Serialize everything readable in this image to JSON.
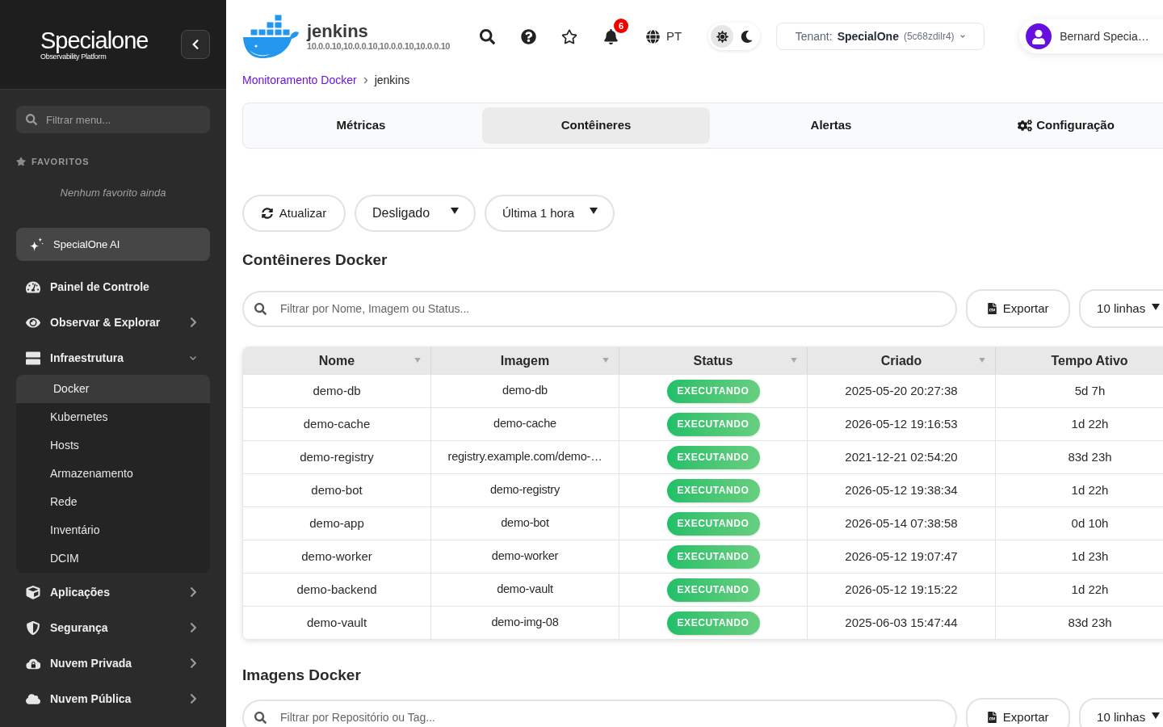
{
  "sidebar": {
    "brand": {
      "name": "Specialone",
      "tagline": "Observability Platform"
    },
    "search": {
      "placeholder": "Filtrar menu..."
    },
    "favorites": {
      "title": "FAVORITOS",
      "empty_text": "Nenhum favorito ainda"
    },
    "ai_button": "SpecialOne AI",
    "nav": [
      {
        "label": "Painel de Controle"
      },
      {
        "label": "Observar & Explorar",
        "expanded": false
      },
      {
        "label": "Infraestrutura",
        "expanded": true,
        "children": [
          {
            "label": "Docker",
            "selected": true
          },
          {
            "label": "Kubernetes",
            "selected": false
          },
          {
            "label": "Hosts",
            "selected": false
          },
          {
            "label": "Armazenamento",
            "selected": false
          },
          {
            "label": "Rede",
            "selected": false
          },
          {
            "label": "Inventário",
            "selected": false
          },
          {
            "label": "DCIM",
            "selected": false
          }
        ]
      },
      {
        "label": "Aplicações",
        "expanded": false
      },
      {
        "label": "Segurança",
        "expanded": false
      },
      {
        "label": "Nuvem Privada",
        "expanded": false
      },
      {
        "label": "Nuvem Pública",
        "expanded": false
      }
    ]
  },
  "header": {
    "title": "jenkins",
    "subtitle": "10.0.0.10,10.0.0.10,10.0.0.10,10.0.0.10",
    "notifications": "6",
    "language": "PT",
    "theme": [
      {
        "kind": "light",
        "selected": true
      },
      {
        "kind": "dark",
        "selected": false
      }
    ],
    "tenant": {
      "label": "Tenant:",
      "name": "SpecialOne",
      "id": "(5c68zdilr4)"
    },
    "user": "Bernard Specia…"
  },
  "breadcrumb": [
    "Monitoramento Docker",
    "jenkins"
  ],
  "tabs": [
    {
      "label": "Métricas",
      "selected": false,
      "kind": "plain"
    },
    {
      "label": "Contêineres",
      "selected": true,
      "kind": "plain"
    },
    {
      "label": "Alertas",
      "selected": false,
      "kind": "plain"
    },
    {
      "label": "Configuração",
      "selected": false,
      "kind": "settings"
    }
  ],
  "controls": {
    "refresh": "Atualizar",
    "auto_refresh": "Desligado",
    "time_range": "Última 1 hora"
  },
  "containers": {
    "title": "Contêineres Docker",
    "search": {
      "placeholder": "Filtrar por Nome, Imagem ou Status..."
    },
    "export": "Exportar",
    "page_size": "10 linhas",
    "table": {
      "columns": [
        {
          "label": "Nome",
          "sortable": true
        },
        {
          "label": "Imagem",
          "sortable": true
        },
        {
          "label": "Status",
          "sortable": true
        },
        {
          "label": "Criado",
          "sortable": true
        },
        {
          "label": "Tempo Ativo"
        }
      ],
      "rows": [
        {
          "name": "demo-db",
          "image": "demo-db",
          "status": {
            "label": "EXECUTANDO",
            "kind": "running"
          },
          "created": "2025-05-20 20:27:38",
          "uptime": "5d 7h"
        },
        {
          "name": "demo-cache",
          "image": "demo-cache",
          "status": {
            "label": "EXECUTANDO",
            "kind": "running"
          },
          "created": "2026-05-12 19:16:53",
          "uptime": "1d 22h"
        },
        {
          "name": "demo-registry",
          "image": "registry.example.com/demo-…",
          "status": {
            "label": "EXECUTANDO",
            "kind": "running"
          },
          "created": "2021-12-21 02:54:20",
          "uptime": "83d 23h"
        },
        {
          "name": "demo-bot",
          "image": "demo-registry",
          "status": {
            "label": "EXECUTANDO",
            "kind": "running"
          },
          "created": "2026-05-12 19:38:34",
          "uptime": "1d 22h"
        },
        {
          "name": "demo-app",
          "image": "demo-bot",
          "status": {
            "label": "EXECUTANDO",
            "kind": "running"
          },
          "created": "2026-05-14 07:38:58",
          "uptime": "0d 10h"
        },
        {
          "name": "demo-worker",
          "image": "demo-worker",
          "status": {
            "label": "EXECUTANDO",
            "kind": "running"
          },
          "created": "2026-05-12 19:07:47",
          "uptime": "1d 23h"
        },
        {
          "name": "demo-backend",
          "image": "demo-vault",
          "status": {
            "label": "EXECUTANDO",
            "kind": "running"
          },
          "created": "2026-05-12 19:15:22",
          "uptime": "1d 22h"
        },
        {
          "name": "demo-vault",
          "image": "demo-img-08",
          "status": {
            "label": "EXECUTANDO",
            "kind": "running"
          },
          "created": "2025-06-03 15:47:44",
          "uptime": "83d 23h"
        }
      ]
    }
  },
  "images": {
    "title": "Imagens Docker",
    "search": {
      "placeholder": "Filtrar por Repositório ou Tag..."
    },
    "export": "Exportar",
    "page_size": "10 linhas"
  }
}
